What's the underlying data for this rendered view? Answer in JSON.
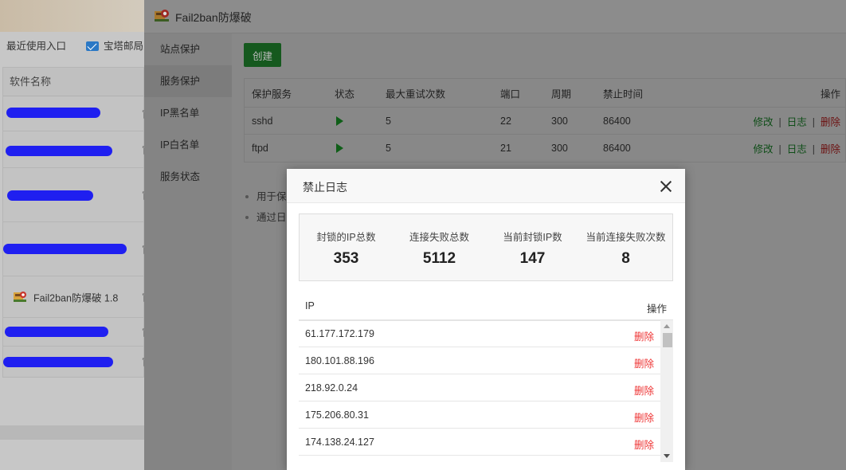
{
  "background": {
    "recent_entry": "最近使用入口",
    "mail_entry": "宝塔邮局",
    "table_header": "软件名称",
    "plugin_name": "Fail2ban防爆破 1.8",
    "row_prefix": "官"
  },
  "window": {
    "title": "Fail2ban防爆破",
    "nav": [
      {
        "label": "站点保护"
      },
      {
        "label": "服务保护"
      },
      {
        "label": "IP黑名单"
      },
      {
        "label": "IP白名单"
      },
      {
        "label": "服务状态"
      }
    ],
    "create_button": "创建",
    "table": {
      "headers": {
        "service": "保护服务",
        "status": "状态",
        "max_retry": "最大重试次数",
        "port": "端口",
        "period": "周期",
        "ban_time": "禁止时间",
        "actions": "操作"
      },
      "rows": [
        {
          "service": "sshd",
          "max_retry": "5",
          "port": "22",
          "period": "300",
          "ban_time": "86400"
        },
        {
          "service": "ftpd",
          "max_retry": "5",
          "port": "21",
          "period": "300",
          "ban_time": "86400"
        }
      ],
      "action_edit": "修改",
      "action_log": "日志",
      "action_delete": "删除",
      "action_sep": "|"
    },
    "notes": [
      "用于保",
      "通过日"
    ]
  },
  "modal": {
    "title": "禁止日志",
    "stats": [
      {
        "label": "封锁的IP总数",
        "value": "353"
      },
      {
        "label": "连接失败总数",
        "value": "5112"
      },
      {
        "label": "当前封锁IP数",
        "value": "147"
      },
      {
        "label": "当前连接失败次数",
        "value": "8"
      }
    ],
    "list_headers": {
      "ip": "IP",
      "action": "操作"
    },
    "rows": [
      {
        "ip": "61.177.172.179",
        "action": "删除"
      },
      {
        "ip": "180.101.88.196",
        "action": "删除"
      },
      {
        "ip": "218.92.0.24",
        "action": "删除"
      },
      {
        "ip": "175.206.80.31",
        "action": "删除"
      },
      {
        "ip": "174.138.24.127",
        "action": "删除"
      }
    ]
  },
  "colors": {
    "primary_green": "#20a53a",
    "delete_red": "#ee3333",
    "overlay": "rgba(0,0,0,0.45)"
  }
}
